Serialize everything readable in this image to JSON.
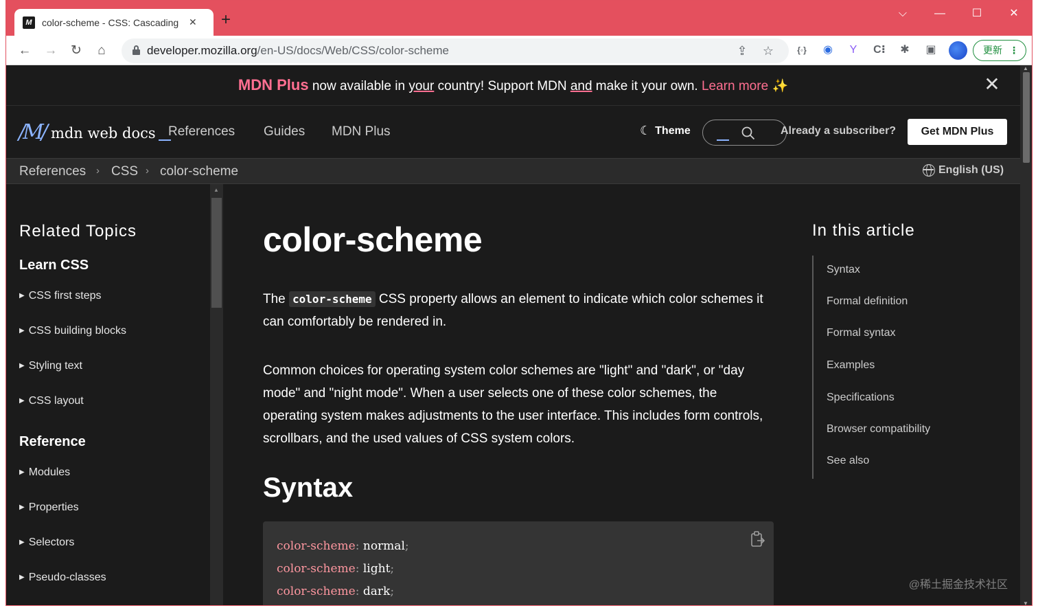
{
  "browser": {
    "tab_title": "color-scheme - CSS: Cascading",
    "favicon_letter": "M",
    "url_host": "developer.mozilla.org",
    "url_path": "/en-US/docs/Web/CSS/color-scheme",
    "update_label": "更新",
    "icons": [
      "back-icon",
      "forward-icon",
      "reload-icon",
      "home-icon",
      "share-icon",
      "star-icon",
      "extensions-icon",
      "sidepanel-icon",
      "menu-icon"
    ]
  },
  "banner": {
    "brand": "MDN Plus",
    "text_1": " now available in ",
    "text_your": "your",
    "text_2": " country! Support MDN ",
    "text_and": "and",
    "text_3": " make it your own. ",
    "learn_more": "Learn more",
    "sparkle": "✨"
  },
  "header": {
    "logo_text": "mdn web docs",
    "nav": [
      "References",
      "Guides",
      "MDN Plus"
    ],
    "theme_label": "Theme",
    "subscriber_label": "Already a subscriber?",
    "cta_label": "Get MDN Plus"
  },
  "breadcrumbs": {
    "items": [
      "References",
      "CSS",
      "color-scheme"
    ],
    "language": "English (US)"
  },
  "sidebar": {
    "title": "Related Topics",
    "section_learn": "Learn CSS",
    "learn_items": [
      "CSS first steps",
      "CSS building blocks",
      "Styling text",
      "CSS layout"
    ],
    "section_reference": "Reference",
    "reference_items": [
      "Modules",
      "Properties",
      "Selectors",
      "Pseudo-classes"
    ]
  },
  "article": {
    "title": "color-scheme",
    "intro_pre": "The ",
    "intro_code": "color-scheme",
    "intro_post": " CSS property allows an element to indicate which color schemes it can comfortably be rendered in.",
    "para2": "Common choices for operating system color schemes are \"light\" and \"dark\", or \"day mode\" and \"night mode\". When a user selects one of these color schemes, the operating system makes adjustments to the user interface. This includes form controls, scrollbars, and the used values of CSS system colors.",
    "syntax_heading": "Syntax",
    "code": [
      {
        "prop": "color-scheme",
        "colon": ": ",
        "value": "normal",
        "semi": ";"
      },
      {
        "prop": "color-scheme",
        "colon": ": ",
        "value": "light",
        "semi": ";"
      },
      {
        "prop": "color-scheme",
        "colon": ": ",
        "value": "dark",
        "semi": ";"
      }
    ]
  },
  "toc": {
    "title": "In this article",
    "items": [
      "Syntax",
      "Formal definition",
      "Formal syntax",
      "Examples",
      "Specifications",
      "Browser compatibility",
      "See also"
    ]
  },
  "watermark": "@稀土掘金技术社区",
  "colors": {
    "accent_pink": "#ff6f91",
    "accent_blue": "#8cb4ff",
    "background": "#1b1b1b",
    "tabstrip": "#e4505e"
  }
}
